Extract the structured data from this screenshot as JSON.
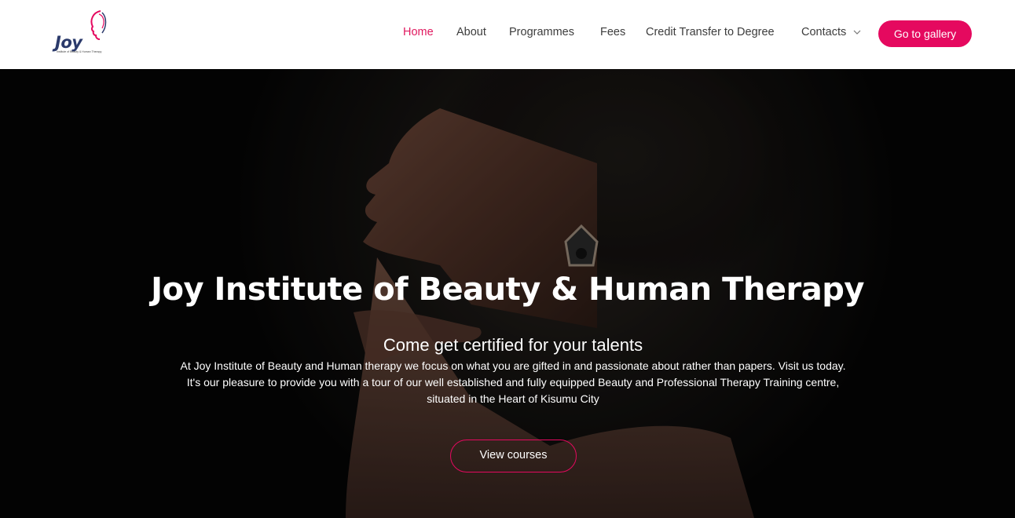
{
  "brand": {
    "logo_word": "Joy",
    "logo_tagline": "Institute of Beauty & Human Therapy",
    "accent": "#e5095f",
    "navy": "#2b3a6b"
  },
  "nav": {
    "items": [
      {
        "label": "Home",
        "active": true
      },
      {
        "label": "About"
      },
      {
        "label": "Programmes"
      },
      {
        "label": "Fees"
      },
      {
        "label": "Credit Transfer to Degree"
      },
      {
        "label": "Contacts",
        "icon": "chevron-down-icon"
      }
    ],
    "cta_label": "Go to gallery"
  },
  "hero": {
    "title": "Joy Institute of Beauty & Human Therapy",
    "subtitle": "Come get certified for your talents",
    "line1": "At Joy Institute of Beauty and Human therapy we focus on what you are gifted in and passionate about rather than papers. Visit us today.",
    "line2": "It's our pleasure to provide you with a tour of our well established and fully equipped Beauty and Professional Therapy Training centre,",
    "line3": "situated in the Heart of Kisumu City",
    "button_label": "View courses"
  }
}
